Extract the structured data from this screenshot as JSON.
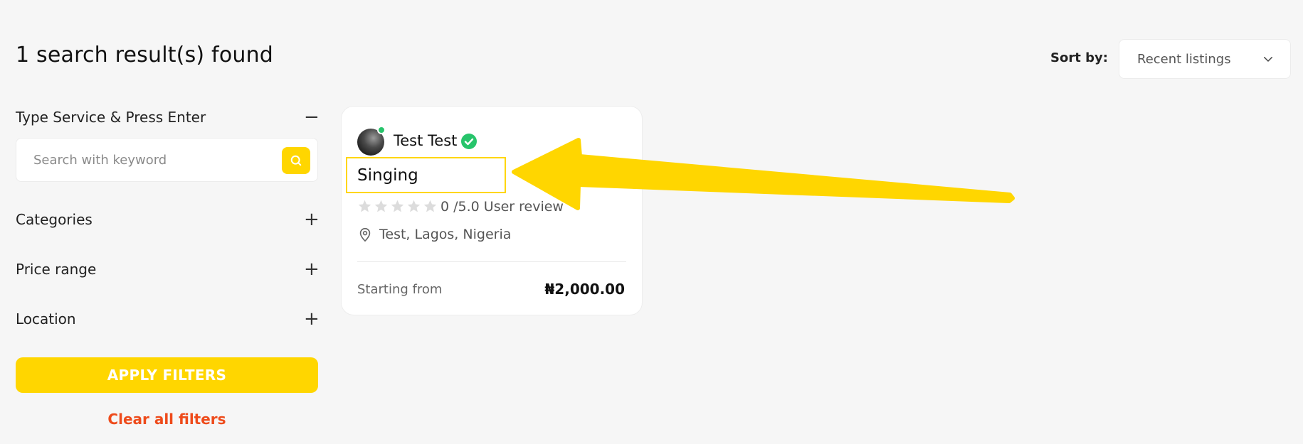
{
  "results": {
    "title": "1 search result(s) found"
  },
  "sort": {
    "label": "Sort by:",
    "selected": "Recent listings"
  },
  "filters": {
    "search_section_title": "Type Service & Press Enter",
    "search_toggle": "−",
    "search_placeholder": "Search with keyword",
    "sections": [
      {
        "label": "Categories",
        "toggle": "+"
      },
      {
        "label": "Price range",
        "toggle": "+"
      },
      {
        "label": "Location",
        "toggle": "+"
      }
    ],
    "apply_label": "APPLY FILTERS",
    "clear_label": "Clear all filters"
  },
  "listing": {
    "seller_name": "Test Test",
    "title": "Singing",
    "rating_text": "0 /5.0 User review",
    "rating": 0,
    "rating_max": 5,
    "location": "Test, Lagos, Nigeria",
    "starting_label": "Starting from",
    "price": "₦2,000.00"
  },
  "colors": {
    "accent": "#ffd600",
    "clear_link": "#ee4b1b",
    "verified": "#27c46b",
    "background": "#f6f6f6"
  },
  "icons": {
    "search": "search-icon",
    "sort": "chevron-down-icon",
    "verified": "verified-check-icon",
    "location": "map-pin-icon",
    "star": "star-icon"
  }
}
